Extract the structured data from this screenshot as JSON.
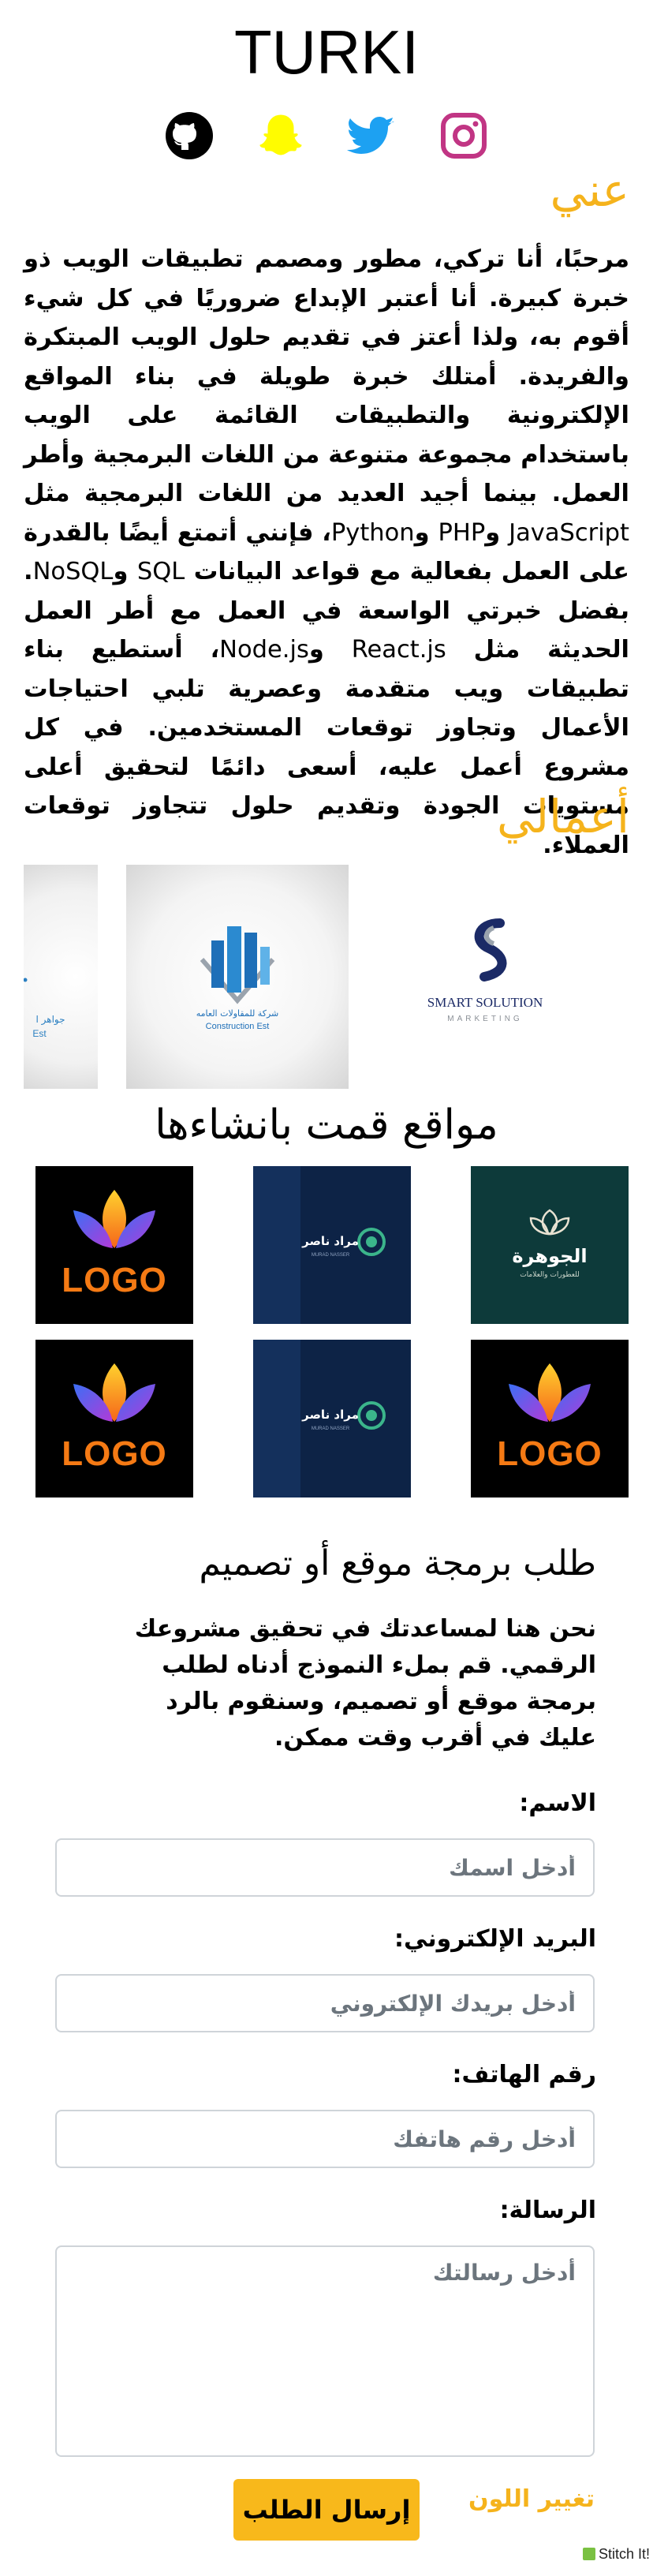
{
  "brand": {
    "name": "TURKI"
  },
  "social": {
    "items": [
      {
        "icon": "github-icon",
        "label": "GitHub",
        "color": "#000000"
      },
      {
        "icon": "snapchat-icon",
        "label": "Snapchat",
        "color": "#FFFC00"
      },
      {
        "icon": "twitter-icon",
        "label": "Twitter",
        "color": "#1DA1F2"
      },
      {
        "icon": "instagram-icon",
        "label": "Instagram",
        "color": "#C13584"
      }
    ]
  },
  "about": {
    "title": "عني",
    "p1": "مرحبًا، أنا تركي، مطور ومصمم تطبيقات الويب ذو خبرة كبيرة. أنا أعتبر الإبداع ضروريًا في كل شيء أقوم به، ولذا أعتز في تقديم حلول الويب المبتكرة والفريدة. أمتلك خبرة طويلة في بناء المواقع الإلكترونية والتطبيقات القائمة على الويب باستخدام مجموعة متنوعة من اللغات البرمجية وأطر العمل. بينما أجيد العديد من اللغات البرمجية مثل",
    "t1": "JavaScript",
    "p2": "و",
    "t2": "PHP",
    "p3": "و",
    "t3": "Python",
    "p4": "، فإنني أتمتع أيضًا بالقدرة على العمل بفعالية مع قواعد البيانات",
    "t4": "SQL",
    "p5": "و",
    "t5": "NoSQL",
    "p6": ". بفضل خبرتي الواسعة في العمل مع أطر العمل الحديثة مثل",
    "t6": "React.js",
    "p7": "و",
    "t7": "Node.js",
    "p8": "، أستطيع بناء تطبيقات ويب متقدمة وعصرية تلبي احتياجات الأعمال وتجاوز توقعات المستخدمين. في كل مشروع أعمل عليه، أسعى دائمًا لتحقيق أعلى مستويات الجودة وتقديم حلول تتجاوز توقعات العملاء."
  },
  "works": {
    "title": "أعمالي",
    "cards": [
      {
        "icon": "partial-logo-icon",
        "line1": "جواهر ا",
        "line2": "Est"
      },
      {
        "icon": "building-logo-icon",
        "line1": "شركة للمقاولات العامه",
        "line2": "Construction Est"
      },
      {
        "icon": "smart-solution-logo-icon",
        "line1": "SMART SOLUTION",
        "line2": "MARKETING"
      }
    ]
  },
  "sites": {
    "title": "مواقع قمت بانشاءها",
    "tiles": [
      {
        "type": "jawhara",
        "title": "الجوهرة",
        "subtitle": "للعطورات والعلامات"
      },
      {
        "type": "murad",
        "title": "مراد ناصر",
        "subtitle": "MURAD NASSER"
      },
      {
        "type": "logo",
        "title": "LOGO"
      },
      {
        "type": "logo",
        "title": "LOGO"
      },
      {
        "type": "murad",
        "title": "مراد ناصر",
        "subtitle": "MURAD NASSER"
      },
      {
        "type": "logo",
        "title": "LOGO"
      }
    ]
  },
  "form": {
    "title": "طلب برمجة موقع أو تصميم",
    "intro": "نحن هنا لمساعدتك في تحقيق مشروعك الرقمي. قم بملء النموذج أدناه لطلب برمجة موقع أو تصميم، وسنقوم بالرد عليك في أقرب وقت ممكن.",
    "name_label": "الاسم:",
    "name_placeholder": "أدخل اسمك",
    "email_label": "البريد الإلكتروني:",
    "email_placeholder": "أدخل بريدك الإلكتروني",
    "phone_label": "رقم الهاتف:",
    "phone_placeholder": "أدخل رقم هاتفك",
    "message_label": "الرسالة:",
    "message_placeholder": "أدخل رسالتك",
    "submit_label": "إرسال الطلب",
    "color_label": "تغيير اللون"
  },
  "badge": {
    "label": "Stitch It!"
  },
  "colors": {
    "accent": "#F5B31C",
    "button": "#F8B81B",
    "navy_tile": "#0D2346",
    "teal_tile": "#0D3A3A"
  }
}
